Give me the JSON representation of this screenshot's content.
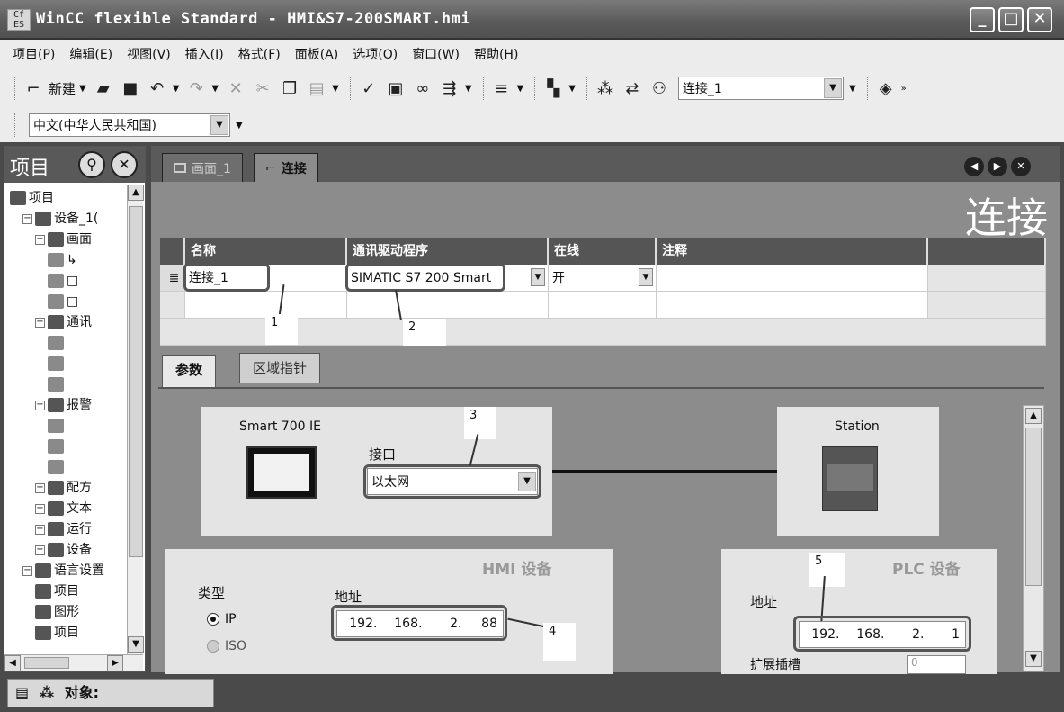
{
  "window": {
    "app_icon_text": "CfN\nES",
    "title": "WinCC flexible Standard - HMI&S7-200SMART.hmi",
    "minimize": "_",
    "maximize": "□",
    "close": "✕"
  },
  "menu": [
    "项目(P)",
    "编辑(E)",
    "视图(V)",
    "插入(I)",
    "格式(F)",
    "面板(A)",
    "选项(O)",
    "窗口(W)",
    "帮助(H)"
  ],
  "toolbar": {
    "new_label": "新建",
    "connection_value": "连接_1",
    "language_value": "中文(中华人民共和国)"
  },
  "project_panel": {
    "title": "项目",
    "tree": [
      {
        "label": "项目",
        "level": 0
      },
      {
        "label": "设备_1(",
        "level": 1
      },
      {
        "label": "画面",
        "level": 2
      },
      {
        "label": "↳",
        "level": 3
      },
      {
        "label": "□",
        "level": 3
      },
      {
        "label": "□",
        "level": 3
      },
      {
        "label": "通讯",
        "level": 2
      },
      {
        "label": "",
        "level": 3
      },
      {
        "label": "",
        "level": 3
      },
      {
        "label": "",
        "level": 3
      },
      {
        "label": "报警",
        "level": 2
      },
      {
        "label": "",
        "level": 3
      },
      {
        "label": "",
        "level": 3
      },
      {
        "label": "",
        "level": 3
      },
      {
        "label": "配方",
        "level": 2
      },
      {
        "label": "文本",
        "level": 2
      },
      {
        "label": "运行",
        "level": 2
      },
      {
        "label": "设备",
        "level": 2
      },
      {
        "label": "语言设置",
        "level": 1
      },
      {
        "label": "项目",
        "level": 2
      },
      {
        "label": "图形",
        "level": 2
      },
      {
        "label": "项目",
        "level": 2
      }
    ]
  },
  "tabs": {
    "screen": "画面_1",
    "connection": "连接"
  },
  "editor_title": "连接",
  "table": {
    "headers": {
      "name": "名称",
      "driver": "通讯驱动程序",
      "online": "在线",
      "comment": "注释"
    },
    "row": {
      "name": "连接_1",
      "driver": "SIMATIC S7 200 Smart",
      "online": "开",
      "comment": ""
    }
  },
  "subtabs": {
    "params": "参数",
    "area": "区域指针"
  },
  "params": {
    "hmi_device_name": "Smart 700 IE",
    "interface_label": "接口",
    "interface_value": "以太网",
    "station_label": "Station",
    "hmi_section_title": "HMI 设备",
    "type_label": "类型",
    "type_ip": "IP",
    "type_iso": "ISO",
    "hmi_address_label": "地址",
    "hmi_ip": [
      "192",
      "168",
      "2",
      "88"
    ],
    "plc_section_title": "PLC 设备",
    "plc_address_label": "地址",
    "plc_ip": [
      "192",
      "168",
      "2",
      "1"
    ],
    "expansion_slot_label": "扩展插槽",
    "expansion_slot_value": "0"
  },
  "annotations": [
    "1",
    "2",
    "3",
    "4",
    "5"
  ],
  "status": {
    "object_label": "对象:"
  }
}
